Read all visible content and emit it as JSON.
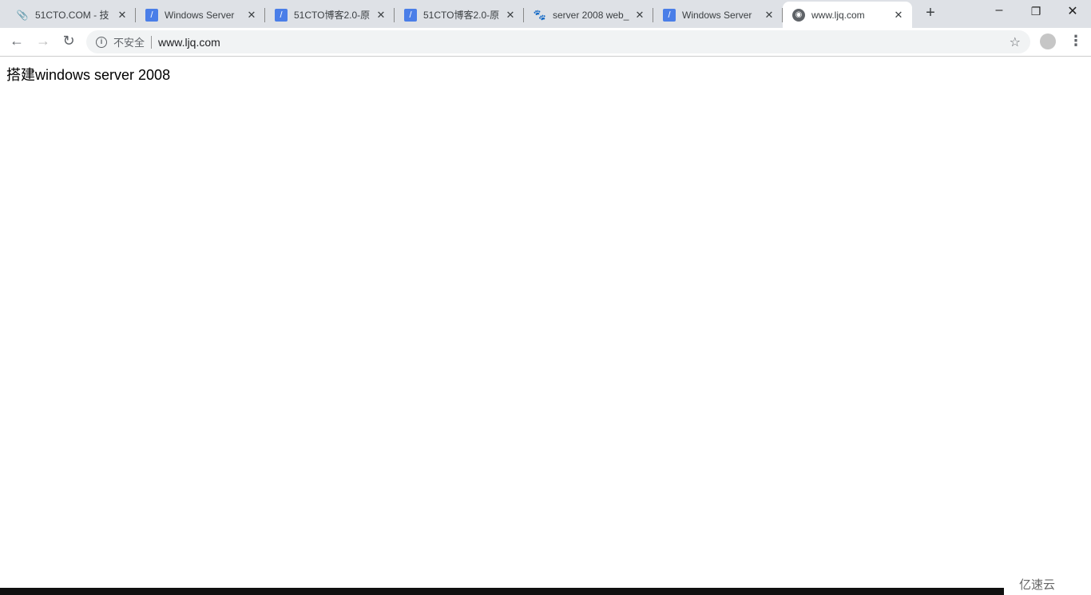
{
  "tabs": [
    {
      "title": "51CTO.COM - 技",
      "icon": "paperclip-icon",
      "active": false
    },
    {
      "title": "Windows Server",
      "icon": "blog-feather-icon",
      "active": false
    },
    {
      "title": "51CTO博客2.0-原",
      "icon": "blog-feather-icon",
      "active": false
    },
    {
      "title": "51CTO博客2.0-原",
      "icon": "blog-feather-icon",
      "active": false
    },
    {
      "title": "server 2008 web_",
      "icon": "baidu-paw-icon",
      "active": false
    },
    {
      "title": "Windows Server",
      "icon": "blog-feather-icon",
      "active": false
    },
    {
      "title": "www.ljq.com",
      "icon": "globe-icon",
      "active": true
    }
  ],
  "omnibox": {
    "security_label": "不安全",
    "url": "www.ljq.com"
  },
  "page": {
    "heading": "搭建windows server 2008"
  },
  "watermark": "亿速云"
}
